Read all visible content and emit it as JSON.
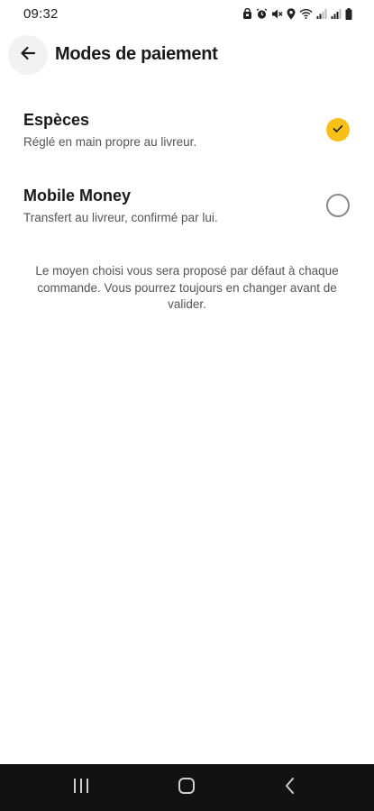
{
  "status_bar": {
    "time": "09:32",
    "icons": [
      "lock-icon",
      "alarm-icon",
      "mute-icon",
      "location-icon",
      "wifi-icon",
      "signal-icon",
      "signal-icon",
      "battery-icon"
    ]
  },
  "header": {
    "title": "Modes de paiement",
    "back_icon": "arrow-left-icon"
  },
  "payment_methods": [
    {
      "title": "Espèces",
      "description": "Réglé en main propre au livreur.",
      "selected": true
    },
    {
      "title": "Mobile Money",
      "description": "Transfert au livreur, confirmé par lui.",
      "selected": false
    }
  ],
  "note": "Le moyen choisi vous sera proposé par défaut à chaque commande. Vous pourrez toujours en changer avant de valider.",
  "navigation_bar": {
    "buttons": [
      "recent-apps-icon",
      "home-icon",
      "back-icon"
    ]
  },
  "colors": {
    "accent": "#f6c019",
    "nav_bar": "#121212"
  }
}
